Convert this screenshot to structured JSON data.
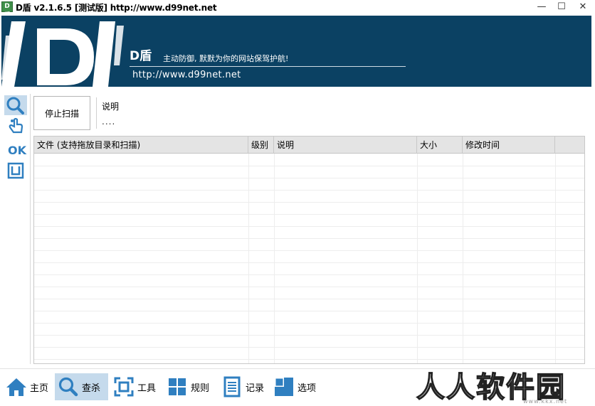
{
  "window": {
    "title": "D盾 v2.1.6.5 [测试版] http://www.d99net.net",
    "app_icon_text": "D盾",
    "minimize": "—",
    "maximize": "☐",
    "close": "✕"
  },
  "banner": {
    "brand": "D盾",
    "slogan": "主动防御, 默默为你的网站保驾护航!",
    "url": "http://www.d99net.net",
    "bg_color": "#0b4163"
  },
  "left_tools": [
    {
      "name": "scan-icon",
      "active": true
    },
    {
      "name": "hand-icon",
      "active": false
    },
    {
      "name": "ok-icon",
      "label": "OK",
      "active": false
    },
    {
      "name": "frame-icon",
      "active": false
    }
  ],
  "scan": {
    "stop_label": "停止扫描",
    "desc_label": "说明",
    "desc_value": "...."
  },
  "table": {
    "columns": [
      {
        "label": "文件 (支持拖放目录和扫描)"
      },
      {
        "label": "级别"
      },
      {
        "label": "说明"
      },
      {
        "label": "大小"
      },
      {
        "label": "修改时间"
      },
      {
        "label": ""
      }
    ],
    "rows": []
  },
  "nav": [
    {
      "label": "主页",
      "icon": "home-icon",
      "active": false
    },
    {
      "label": "查杀",
      "icon": "search-icon",
      "active": true
    },
    {
      "label": "工具",
      "icon": "tools-icon",
      "active": false
    },
    {
      "label": "规则",
      "icon": "rules-icon",
      "active": false
    },
    {
      "label": "记录",
      "icon": "log-icon",
      "active": false
    },
    {
      "label": "选项",
      "icon": "options-icon",
      "active": false
    }
  ],
  "watermark": {
    "text": "人人软件园",
    "sub": "www.kkx.net"
  },
  "colors": {
    "accent": "#2f7fc0",
    "active_bg": "#c5daec"
  }
}
